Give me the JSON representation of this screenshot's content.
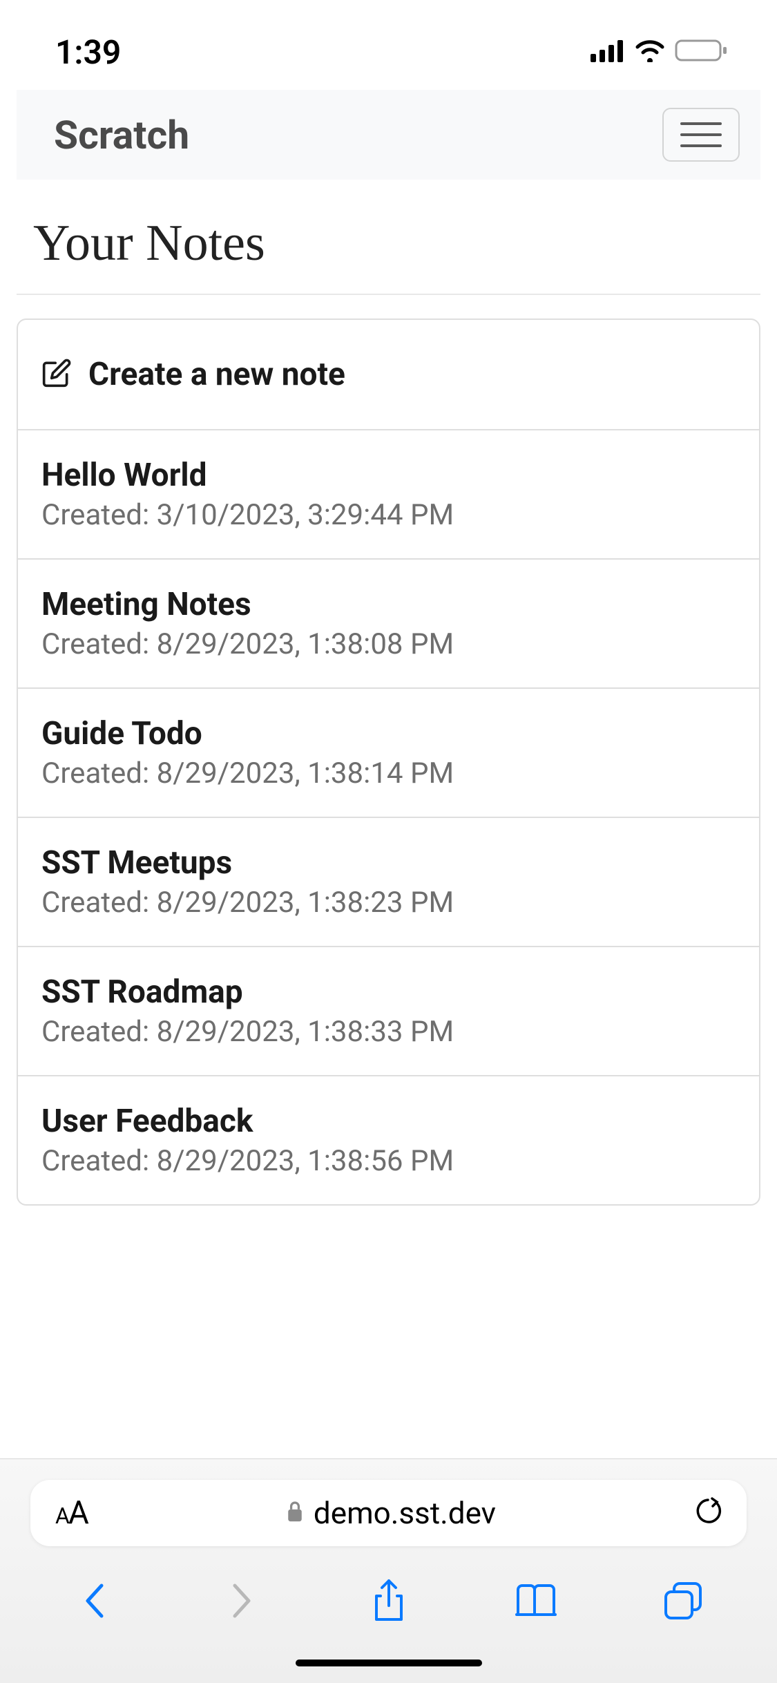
{
  "status": {
    "time": "1:39"
  },
  "navbar": {
    "brand": "Scratch"
  },
  "page": {
    "title": "Your Notes"
  },
  "create": {
    "label": "Create a new note"
  },
  "notes": [
    {
      "title": "Hello World",
      "created": "Created: 3/10/2023, 3:29:44 PM"
    },
    {
      "title": "Meeting Notes",
      "created": "Created: 8/29/2023, 1:38:08 PM"
    },
    {
      "title": "Guide Todo",
      "created": "Created: 8/29/2023, 1:38:14 PM"
    },
    {
      "title": "SST Meetups",
      "created": "Created: 8/29/2023, 1:38:23 PM"
    },
    {
      "title": "SST Roadmap",
      "created": "Created: 8/29/2023, 1:38:33 PM"
    },
    {
      "title": "User Feedback",
      "created": "Created: 8/29/2023, 1:38:56 PM"
    }
  ],
  "browser": {
    "fontButton": "AA",
    "url": "demo.sst.dev"
  }
}
